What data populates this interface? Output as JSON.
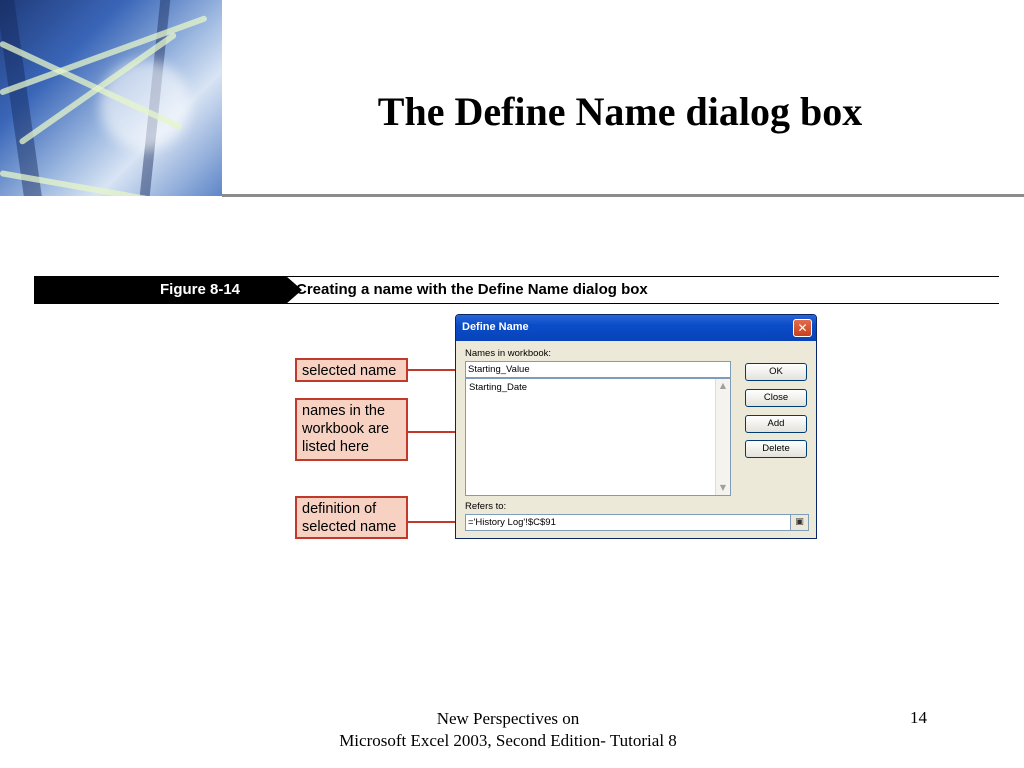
{
  "slide": {
    "title": "The Define Name dialog box",
    "footer_line1": "New Perspectives on",
    "footer_line2": "Microsoft Excel 2003, Second Edition- Tutorial 8",
    "page_number": "14"
  },
  "figure": {
    "label": "Figure 8-14",
    "caption": "Creating a name with the Define Name dialog box"
  },
  "callouts": {
    "selected_name": "selected name",
    "names_listed_line1": "names in the",
    "names_listed_line2": "workbook are",
    "names_listed_line3": "listed here",
    "definition_line1": "definition of",
    "definition_line2": "selected name"
  },
  "dialog": {
    "title": "Define Name",
    "close_glyph": "✕",
    "names_label": "Names in workbook:",
    "name_input_value": "Starting_Value",
    "names_list": [
      "Starting_Date"
    ],
    "refers_label": "Refers to:",
    "refers_value": "='History Log'!$C$91",
    "buttons": {
      "ok": "OK",
      "close": "Close",
      "add": "Add",
      "delete": "Delete"
    },
    "collapse_icon": "range-select-icon"
  },
  "colors": {
    "callout_fill": "#f7d2c2",
    "callout_border": "#c0392b",
    "titlebar": "#0a4cc8"
  }
}
